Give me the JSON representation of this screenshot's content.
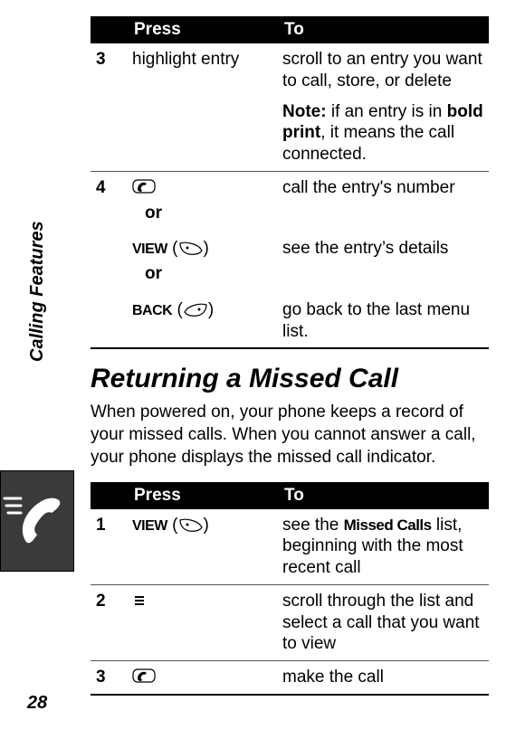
{
  "sidebar_label": "Calling Features",
  "page_number": "28",
  "table1": {
    "header_press": "Press",
    "header_to": "To",
    "rows": {
      "r3_num": "3",
      "r3_press": "highlight entry",
      "r3_to_a": "scroll to an entry you want to call, store, or delete",
      "r3_note_label": "Note:",
      "r3_note_a": " if an entry is in ",
      "r3_note_bold": "bold print",
      "r3_note_b": ", it means the call connected.",
      "r4_num": "4",
      "r4_to_a": "call the entry's number",
      "r4_or1": "or",
      "r4_view": "VIEW",
      "r4_to_b": "see the entry’s details",
      "r4_or2": "or",
      "r4_back": "BACK",
      "r4_to_c": "go back to the last menu list."
    }
  },
  "section_title": "Returning a Missed Call",
  "intro_text": "When powered on, your phone keeps a record of your missed calls. When you cannot answer a call, your phone displays the missed call indicator.",
  "table2": {
    "header_press": "Press",
    "header_to": "To",
    "rows": {
      "r1_num": "1",
      "r1_view": "VIEW",
      "r1_to_a": "see the ",
      "r1_to_bold": "Missed Calls",
      "r1_to_b": " list, beginning with the most recent call",
      "r2_num": "2",
      "r2_to": "scroll through the list and select a call that you want to view",
      "r3_num": "3",
      "r3_to": "make the call"
    }
  },
  "icons": {
    "send_key": "send-key-icon",
    "softkey_right": "softkey-right-icon",
    "softkey_left": "softkey-left-icon",
    "nav_key": "nav-key-icon",
    "phone_badge": "phone-badge-icon"
  }
}
